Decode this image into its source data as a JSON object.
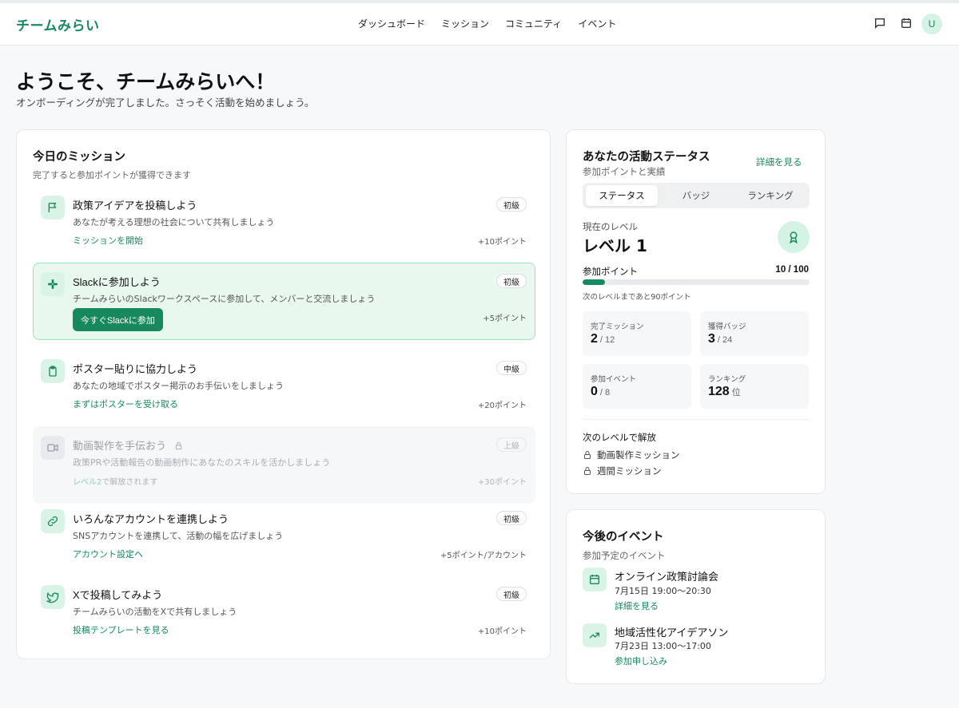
{
  "header": {
    "logo": "チームみらい",
    "nav": [
      "ダッシュボード",
      "ミッション",
      "コミュニティ",
      "イベント"
    ],
    "avatar": "U"
  },
  "welcome": {
    "title": "ようこそ、チームみらいへ！",
    "subtitle": "オンボーディングが完了しました。さっそく活動を始めましょう。"
  },
  "missions": {
    "title": "今日のミッション",
    "subtitle": "完了すると参加ポイントが獲得できます",
    "items": [
      {
        "icon": "flag-icon",
        "title": "政策アイデアを投稿しよう",
        "badge": "初級",
        "desc": "あなたが考える理想の社会について共有しましょう",
        "link": "ミッションを開始",
        "points": "+10ポイント"
      },
      {
        "icon": "slack-icon",
        "title": "Slackに参加しよう",
        "badge": "初級",
        "desc": "チームみらいのSlackワークスペースに参加して、メンバーと交流しましょう",
        "button": "今すぐSlackに参加",
        "points": "+5ポイント"
      },
      {
        "icon": "clipboard-icon",
        "title": "ポスター貼りに協力しよう",
        "badge": "中級",
        "desc": "あなたの地域でポスター掲示のお手伝いをしましょう",
        "link": "まずはポスターを受け取る",
        "points": "+20ポイント"
      },
      {
        "icon": "video-icon",
        "title": "動画製作を手伝おう",
        "badge": "上級",
        "desc": "政策PRや活動報告の動画制作にあなたのスキルを活かしましょう",
        "link_prefix": "レベル2",
        "link_suffix": "で解放されます",
        "points": "+30ポイント"
      },
      {
        "icon": "link-icon",
        "title": "いろんなアカウントを連携しよう",
        "badge": "初級",
        "desc": "SNSアカウントを連携して、活動の幅を広げましょう",
        "link": "アカウント設定へ",
        "points": "+5ポイント/アカウント"
      },
      {
        "icon": "twitter-bird-icon",
        "title": "Xで投稿してみよう",
        "badge": "初級",
        "desc": "チームみらいの活動をXで共有しましょう",
        "link": "投稿テンプレートを見る",
        "points": "+10ポイント"
      }
    ]
  },
  "status": {
    "title": "あなたの活動ステータス",
    "subtitle": "参加ポイントと実績",
    "detail_link": "詳細を見る",
    "tabs": [
      "ステータス",
      "バッジ",
      "ランキング"
    ],
    "current_level_label": "現在のレベル",
    "current_level": "レベル 1",
    "points_label": "参加ポイント",
    "points_value": "10 / 100",
    "progress_fraction": 0.1,
    "next_level_text": "次のレベルまであと90ポイント",
    "stats": [
      {
        "label": "完了ミッション",
        "value": "2",
        "unit": "/ 12"
      },
      {
        "label": "獲得バッジ",
        "value": "3",
        "unit": "/ 24"
      },
      {
        "label": "参加イベント",
        "value": "0",
        "unit": "/ 8"
      },
      {
        "label": "ランキング",
        "value": "128",
        "unit": "位"
      }
    ],
    "unlock_title": "次のレベルで解放",
    "unlocks": [
      "動画製作ミッション",
      "週間ミッション"
    ]
  },
  "events": {
    "title": "今後のイベント",
    "subtitle": "参加予定のイベント",
    "items": [
      {
        "icon": "calendar-icon",
        "title": "オンライン政策討論会",
        "date": "7月15日 19:00〜20:30",
        "link": "詳細を見る"
      },
      {
        "icon": "trending-up-icon",
        "title": "地域活性化アイデアソン",
        "date": "7月23日 13:00〜17:00",
        "link": "参加申し込み"
      }
    ]
  },
  "colors": {
    "brand": "#18895f",
    "highlight_bg": "#e8f8ef",
    "highlight_border": "#9fe0bf"
  }
}
